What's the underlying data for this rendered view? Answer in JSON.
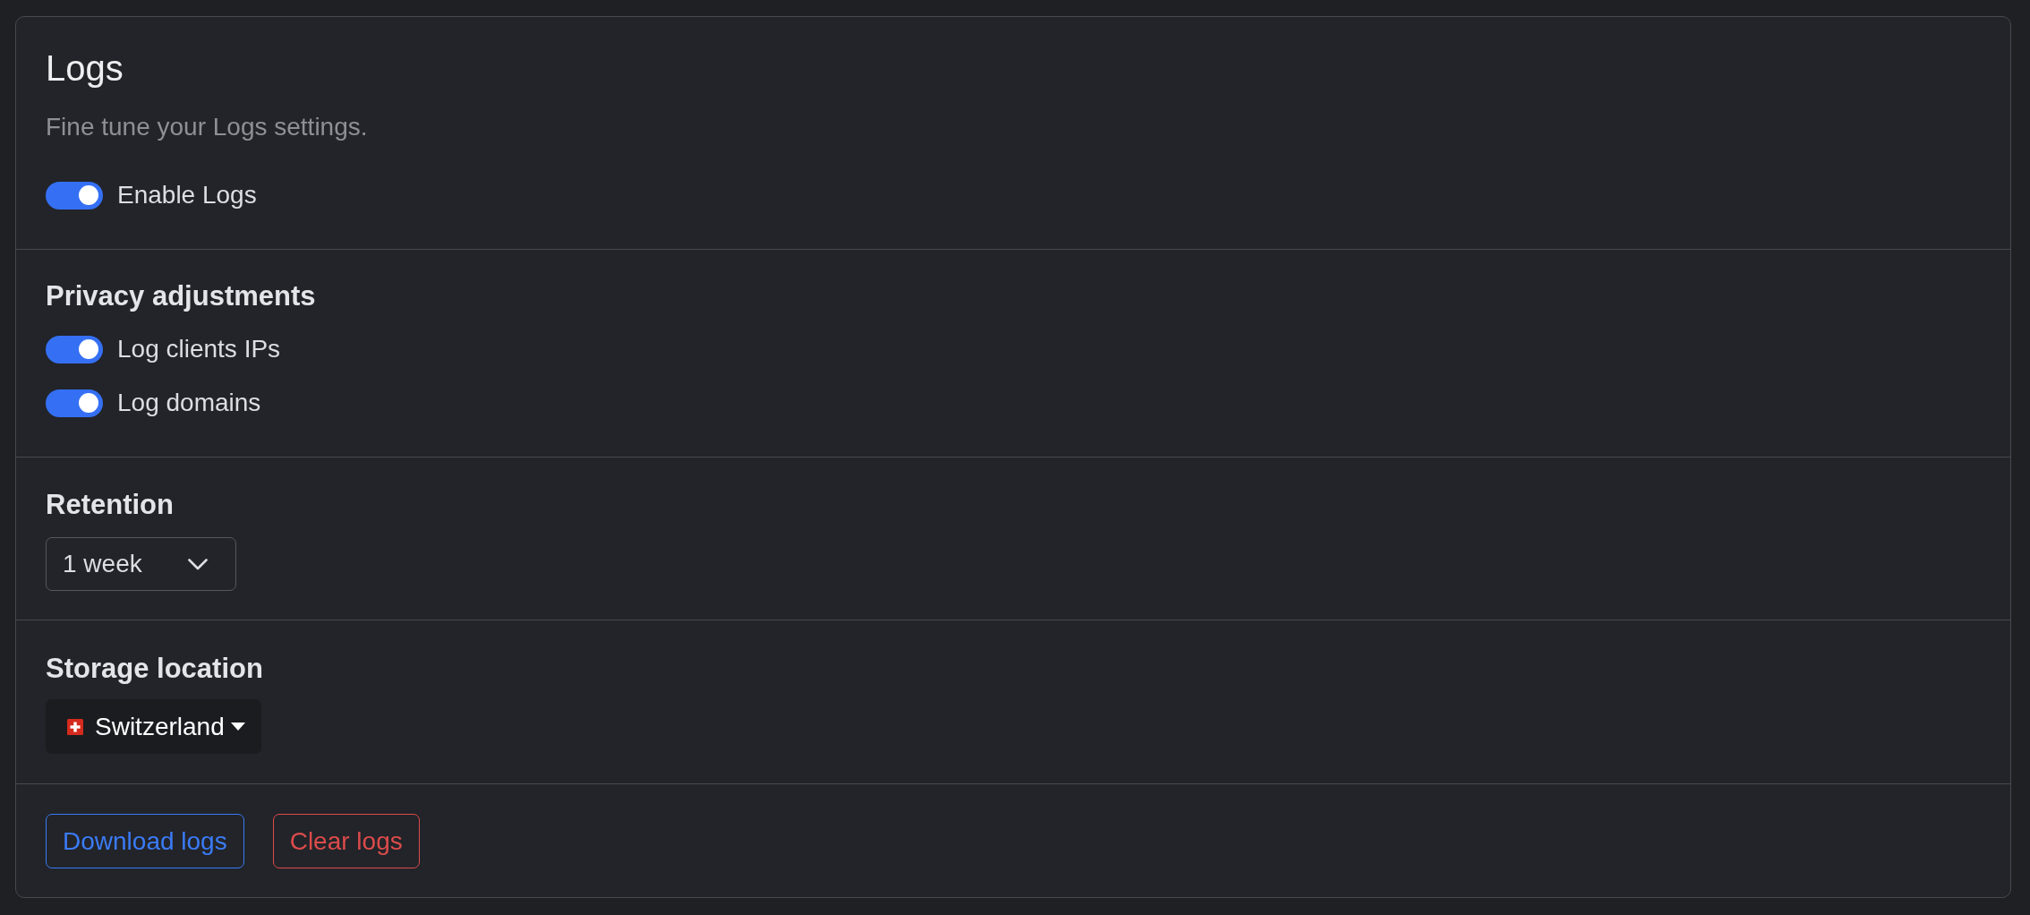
{
  "header": {
    "title": "Logs",
    "subtitle": "Fine tune your Logs settings.",
    "toggles": [
      {
        "label": "Enable Logs",
        "on": true
      }
    ]
  },
  "sections": [
    {
      "kind": "toggles",
      "heading": "Privacy adjustments",
      "toggles": [
        {
          "label": "Log clients IPs",
          "on": true
        },
        {
          "label": "Log domains",
          "on": true
        }
      ]
    },
    {
      "kind": "select",
      "heading": "Retention",
      "value": "1 week"
    },
    {
      "kind": "country_select",
      "heading": "Storage location",
      "value": "Switzerland"
    }
  ],
  "actions": [
    {
      "label": "Download logs",
      "kind": "primary"
    },
    {
      "label": "Clear logs",
      "kind": "danger"
    }
  ]
}
